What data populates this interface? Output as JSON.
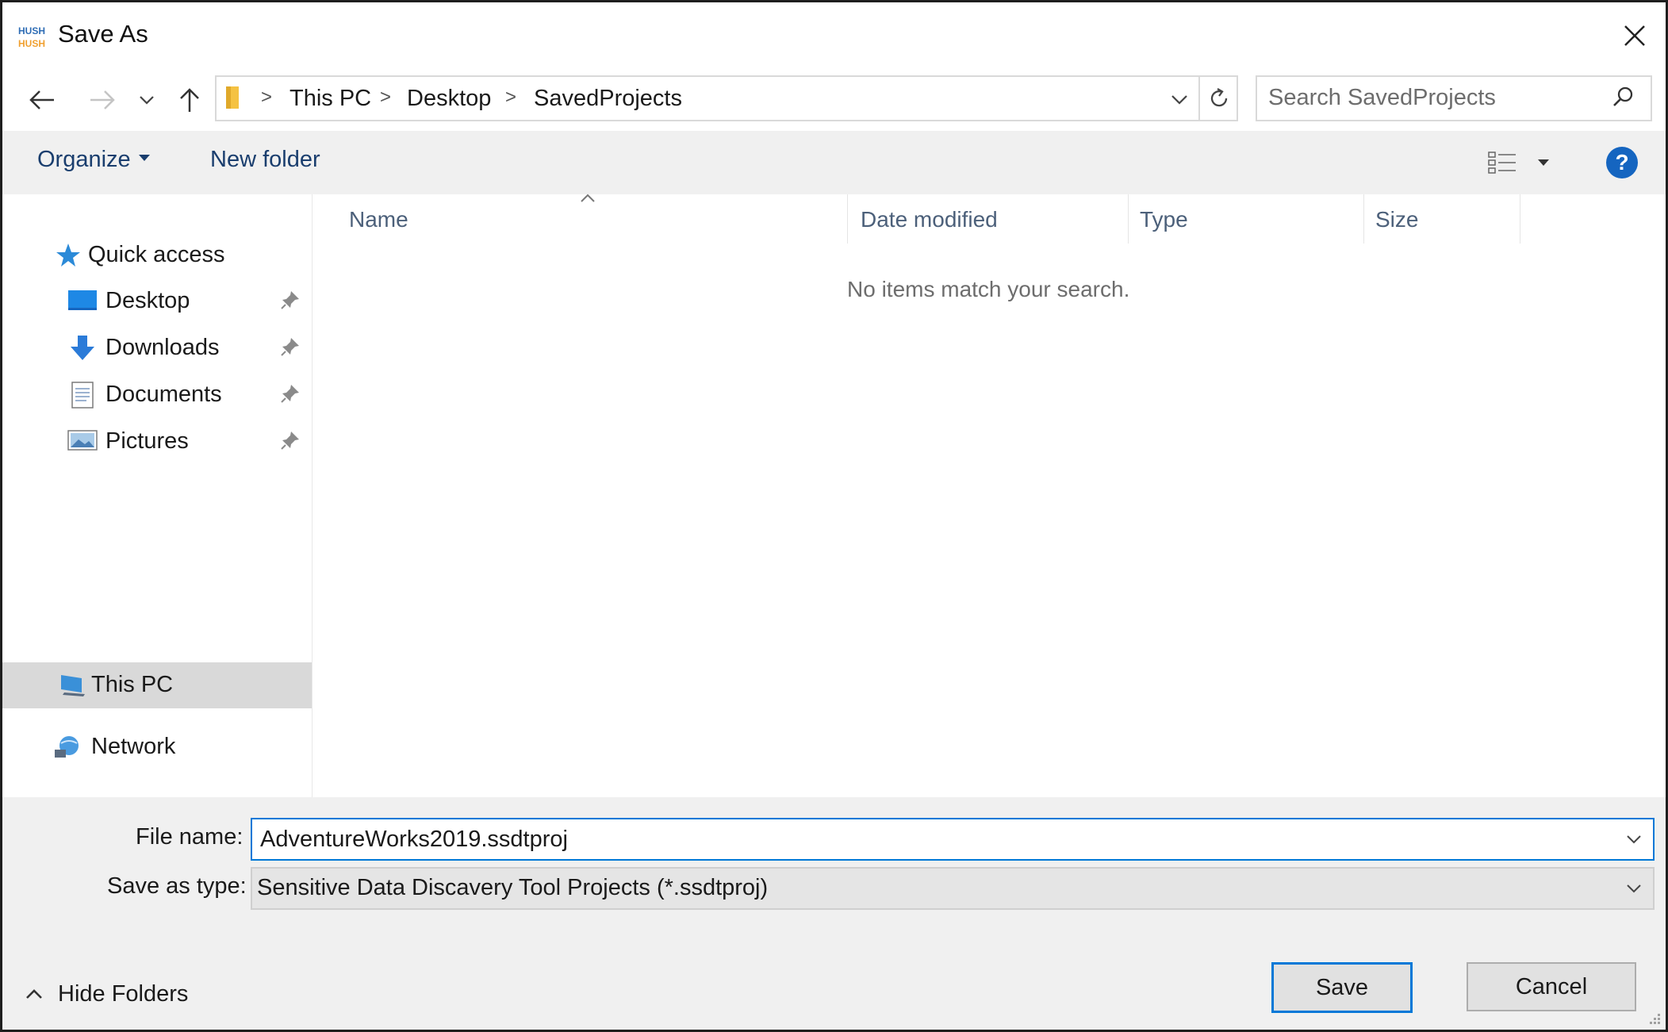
{
  "window": {
    "title": "Save As",
    "logo_text_top": "HUSH",
    "logo_text_bottom": "HUSH"
  },
  "nav": {
    "breadcrumb": [
      "This PC",
      "Desktop",
      "SavedProjects"
    ],
    "search_placeholder": "Search SavedProjects"
  },
  "toolbar": {
    "organize_label": "Organize",
    "new_folder_label": "New folder",
    "help_label": "?"
  },
  "sidebar": {
    "quick_access": "Quick access",
    "pinned": [
      {
        "label": "Desktop",
        "icon": "desktop-icon"
      },
      {
        "label": "Downloads",
        "icon": "downloads-icon"
      },
      {
        "label": "Documents",
        "icon": "documents-icon"
      },
      {
        "label": "Pictures",
        "icon": "pictures-icon"
      }
    ],
    "this_pc": "This PC",
    "network": "Network"
  },
  "filelist": {
    "columns": [
      "Name",
      "Date modified",
      "Type",
      "Size"
    ],
    "empty_message": "No items match your search."
  },
  "footer": {
    "file_name_label": "File name:",
    "file_name_value": "AdventureWorks2019.ssdtproj",
    "save_type_label": "Save as type:",
    "save_type_value": "Sensitive Data Discavery Tool Projects (*.ssdtproj)",
    "hide_folders_label": "Hide Folders",
    "save_label": "Save",
    "cancel_label": "Cancel"
  },
  "colors": {
    "accent": "#0078d7",
    "toolbar_bg": "#f0f0f0",
    "link_text": "#1a3e6e",
    "help_blue": "#1565c0"
  }
}
